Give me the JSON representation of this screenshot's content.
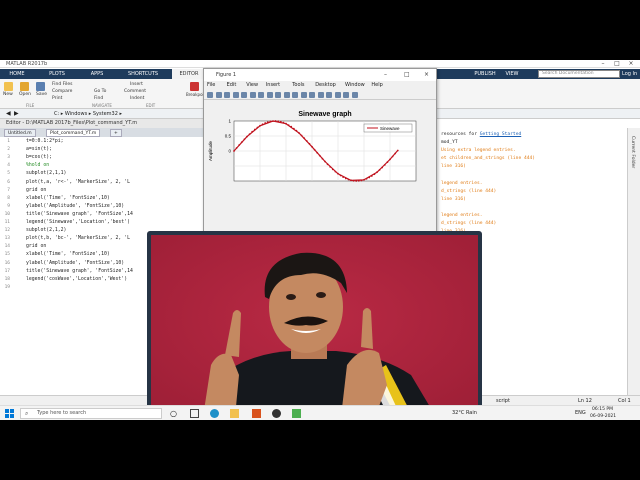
{
  "window": {
    "title": "MATLAB R2017b"
  },
  "ribbon": {
    "tabs": [
      "HOME",
      "PLOTS",
      "APPS",
      "SHORTCUTS",
      "EDITOR",
      "PUBLISH",
      "VIEW"
    ],
    "active_tab": "EDITOR",
    "search_placeholder": "Search Documentation",
    "login": "Log In",
    "buttons": {
      "new": "New",
      "open": "Open",
      "save": "Save",
      "find_files": "Find Files",
      "compare": "Compare",
      "print": "Print",
      "go_to": "Go To",
      "find": "Find",
      "insert": "Insert",
      "comment": "Comment",
      "indent": "Indent",
      "breakpoints": "Breakpoints"
    },
    "sections": {
      "file": "FILE",
      "navigate": "NAVIGATE",
      "edit": "EDIT"
    }
  },
  "address": {
    "path": "C: ▸ Windows ▸ System32 ▸"
  },
  "editor": {
    "title": "Editor - D:\\MATLAB 2017b_Files\\Plot_command_YT.m",
    "tabs": [
      "Untitled.m",
      "Plot_command_YT.m",
      "+"
    ],
    "lines": [
      {
        "n": "1",
        "code": "t=0:0.1:2*pi;"
      },
      {
        "n": "2",
        "code": "a=sin(t);"
      },
      {
        "n": "3",
        "code": "b=cos(t);"
      },
      {
        "n": "4",
        "code": "%hold on"
      },
      {
        "n": "5",
        "code": "subplot(2,1,1)"
      },
      {
        "n": "6",
        "code": "plot(t,a, 'r<-', 'MarkerSize', 2, 'L"
      },
      {
        "n": "7",
        "code": "grid on"
      },
      {
        "n": "8",
        "code": "xlabel('Time', 'FontSize',10)"
      },
      {
        "n": "9",
        "code": "ylabel('Amplitude', 'FontSize',10)"
      },
      {
        "n": "10",
        "code": "title('Sinewave graph', 'FontSize',14"
      },
      {
        "n": "11",
        "code": "legend('Sinewave','Location','best')"
      },
      {
        "n": "12",
        "code": "subplot(2,1,2)"
      },
      {
        "n": "13",
        "code": "plot(t,b, 'bc-', 'MarkerSize', 2, 'L"
      },
      {
        "n": "14",
        "code": "grid on"
      },
      {
        "n": "15",
        "code": "xlabel('Time', 'FontSize',10)"
      },
      {
        "n": "16",
        "code": "ylabel('Amplitude', 'FontSize',10)"
      },
      {
        "n": "17",
        "code": "title('Sinewave graph', 'FontSize',14"
      },
      {
        "n": "18",
        "code": "legend('cosWave','Location','West')"
      },
      {
        "n": "19",
        "code": ""
      }
    ]
  },
  "figure": {
    "title": "Figure 1",
    "menu": [
      "File",
      "Edit",
      "View",
      "Insert",
      "Tools",
      "Desktop",
      "Window",
      "Help"
    ],
    "plot_title": "Sinewave graph",
    "ylabel": "Amplitude",
    "legend": "Sinewave",
    "yticks": [
      "1",
      "0.5",
      "0"
    ]
  },
  "chart_data": {
    "type": "line",
    "title": "Sinewave graph",
    "ylabel": "Amplitude",
    "xlabel": "",
    "ylim": [
      -1,
      1
    ],
    "xlim": [
      0,
      7
    ],
    "grid": true,
    "legend_position": "top-right",
    "series": [
      {
        "name": "Sinewave",
        "color": "#c0121e",
        "x": [
          0,
          0.5,
          1,
          1.5,
          2,
          2.5,
          3,
          3.5,
          4,
          4.5,
          5,
          5.5,
          6,
          6.3
        ],
        "y": [
          0,
          0.48,
          0.84,
          1.0,
          0.91,
          0.6,
          0.14,
          -0.35,
          -0.76,
          -0.98,
          -0.96,
          -0.71,
          -0.28,
          0.02
        ]
      }
    ]
  },
  "command_window": {
    "lines": [
      {
        "text": "resources for ",
        "link": "Getting Started",
        "color": "#222"
      },
      {
        "text": "mod_YT",
        "link": "",
        "color": "#222"
      },
      {
        "text": "Using extra legend entries.",
        "link": "",
        "color": "#e07b14"
      },
      {
        "text": "et children_and_strings (line 444)",
        "link": "",
        "color": "#e07b14"
      },
      {
        "text": "line 316)",
        "link": "",
        "color": "#e07b14"
      },
      {
        "text": "",
        "link": "",
        "color": "#222"
      },
      {
        "text": "legend entries.",
        "link": "",
        "color": "#e07b14"
      },
      {
        "text": "d_strings (line 444)",
        "link": "",
        "color": "#e07b14"
      },
      {
        "text": "line 316)",
        "link": "",
        "color": "#e07b14"
      },
      {
        "text": "",
        "link": "",
        "color": "#222"
      },
      {
        "text": "legend entries.",
        "link": "",
        "color": "#e07b14"
      },
      {
        "text": "d_strings (line 444)",
        "link": "",
        "color": "#e07b14"
      },
      {
        "text": "line 316)",
        "link": "",
        "color": "#e07b14"
      }
    ]
  },
  "sidebar": {
    "label": "Current Folder"
  },
  "status": {
    "left": "script",
    "ln": "Ln 12",
    "col": "Col 1"
  },
  "taskbar": {
    "search": "Type here to search",
    "weather": "32°C Rain",
    "lang": "ENG",
    "time": "06:15 PM",
    "date": "06-09-2021"
  }
}
